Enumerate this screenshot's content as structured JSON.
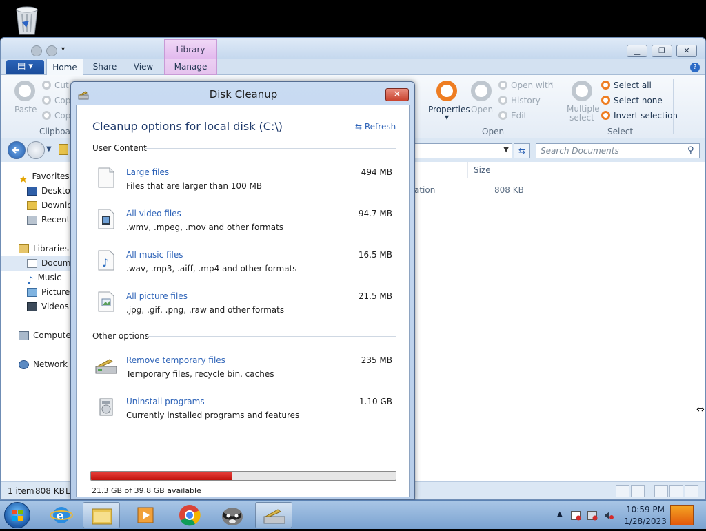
{
  "explorer": {
    "qat_icons": [
      "properties-icon",
      "new-folder-icon",
      "customize-qat-icon"
    ],
    "contextual_tab_label": "Library Tools",
    "tabs": [
      {
        "label": "Home",
        "active": true
      },
      {
        "label": "Share",
        "active": false
      },
      {
        "label": "View",
        "active": false
      },
      {
        "label": "Manage",
        "active": false
      }
    ],
    "ribbon": {
      "clipboard": {
        "paste": "Paste",
        "cut": "Cut",
        "copy": "Copy",
        "copy2": "Copy",
        "group": "Clipboard"
      },
      "open": {
        "properties": "Properties",
        "open": "Open",
        "open_with": "Open with",
        "history": "History",
        "edit": "Edit",
        "group": "Open"
      },
      "select": {
        "multiple": "Multiple\nselect",
        "select_all": "Select all",
        "select_none": "Select none",
        "invert": "Invert selection",
        "group": "Select"
      }
    },
    "search_placeholder": "Search Documents",
    "nav_pane": [
      {
        "label": "Favorites",
        "icon": "star-icon"
      },
      {
        "label": "Desktop",
        "icon": "desktop-icon"
      },
      {
        "label": "Downloads",
        "icon": "downloads-folder-icon"
      },
      {
        "label": "Recent Places",
        "icon": "recent-places-icon"
      },
      {
        "label": "Libraries",
        "icon": "libraries-icon"
      },
      {
        "label": "Documents",
        "icon": "documents-icon",
        "selected": true
      },
      {
        "label": "Music",
        "icon": "music-note-icon"
      },
      {
        "label": "Pictures",
        "icon": "pictures-icon"
      },
      {
        "label": "Videos",
        "icon": "videos-icon"
      },
      {
        "label": "Computer",
        "icon": "computer-icon"
      },
      {
        "label": "Network",
        "icon": "network-icon"
      }
    ],
    "columns": {
      "size": "Size"
    },
    "row": {
      "type_fragment": "ation",
      "size": "808 KB"
    },
    "status": {
      "items": "1 item",
      "size": "808 KB",
      "extra": "L"
    }
  },
  "dialog": {
    "title": "Disk Cleanup",
    "heading": "Cleanup options for local disk (C:\\)",
    "refresh": "Refresh",
    "user_content_label": "User Content",
    "user_items": [
      {
        "title": "Large files",
        "desc": "Files that are larger than 100 MB",
        "size": "494 MB",
        "icon": "blank-file-icon"
      },
      {
        "title": "All video files",
        "desc": ".wmv, .mpeg, .mov and other formats",
        "size": "94.7 MB",
        "icon": "video-file-icon"
      },
      {
        "title": "All music files",
        "desc": ".wav, .mp3, .aiff, .mp4 and other formats",
        "size": "16.5 MB",
        "icon": "music-file-icon"
      },
      {
        "title": "All picture files",
        "desc": ".jpg, .gif, .png, .raw and other formats",
        "size": "21.5 MB",
        "icon": "picture-file-icon"
      }
    ],
    "other_options_label": "Other options",
    "other_items": [
      {
        "title": "Remove temporary files",
        "desc": "Temporary files, recycle bin, caches",
        "size": "235 MB",
        "icon": "disk-cleanup-icon"
      },
      {
        "title": "Uninstall programs",
        "desc": "Currently installed programs and features",
        "size": "1.10 GB",
        "icon": "programs-icon"
      }
    ],
    "usage_fraction": 0.4648,
    "availability": "21.3 GB of 39.8 GB available",
    "accent_color": "#2f64b8",
    "bar_color": "#d42a22"
  },
  "taskbar": {
    "apps": [
      "file-explorer-icon",
      "media-player-icon",
      "chrome-icon",
      "raccoon-app-icon",
      "disk-cleanup-icon"
    ],
    "time": "10:59 PM",
    "date": "1/28/2023"
  }
}
